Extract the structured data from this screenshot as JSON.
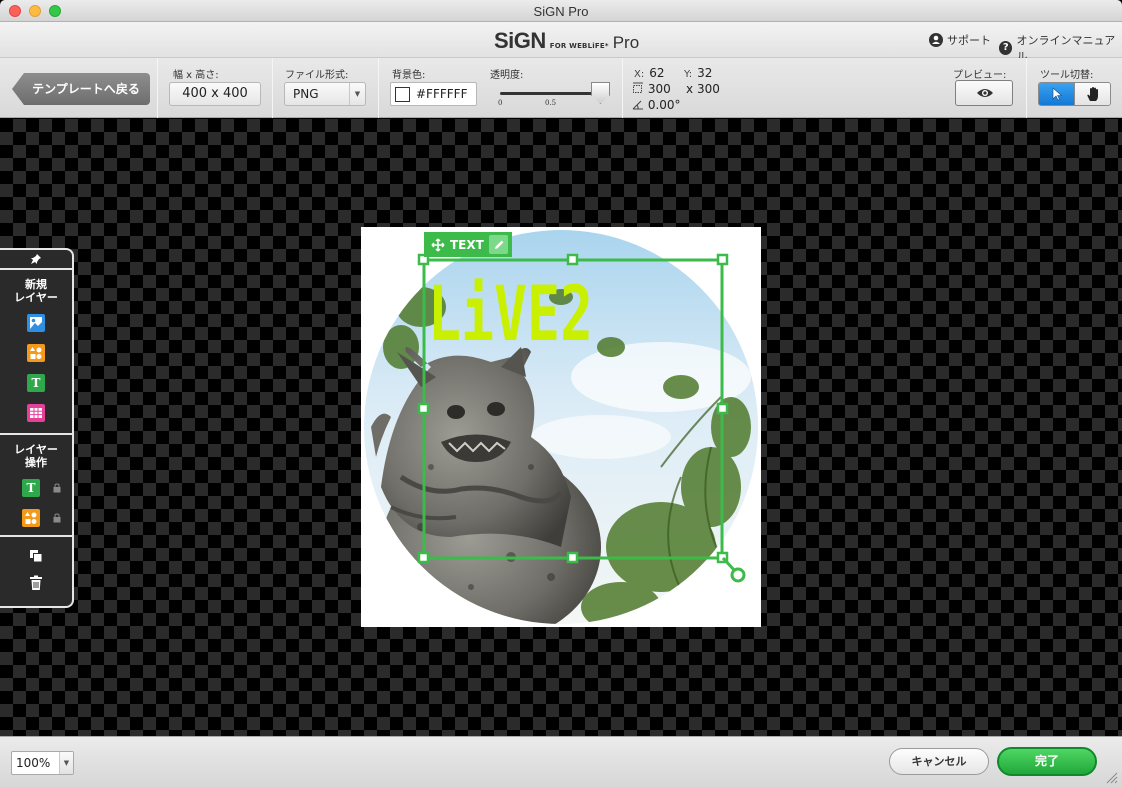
{
  "window": {
    "title": "SiGN Pro"
  },
  "header": {
    "logo_main": "SiGN",
    "logo_sub": "FOR WEBLiFE*",
    "logo_pro": "Pro",
    "support": "サポート",
    "manual": "オンラインマニュアル"
  },
  "toolbar": {
    "back": "テンプレートへ戻る",
    "size_label": "幅 x 高さ:",
    "size_value": "400 x 400",
    "format_label": "ファイル形式:",
    "format_value": "PNG",
    "bg_label": "背景色:",
    "bg_value": "#FFFFFF",
    "bg_color": "#FFFFFF",
    "opacity_label": "透明度:",
    "opacity_value": 1.0,
    "opacity_tick_0": "0",
    "opacity_tick_05": "0.5",
    "x_label": "X:",
    "x_value": "62",
    "y_label": "Y:",
    "y_value": "32",
    "w_value": "300",
    "h_prefix": "x",
    "h_value": "300",
    "angle_value": "0.00°",
    "preview_label": "プレビュー:",
    "tool_label": "ツール切替:"
  },
  "canvas": {
    "layer_tag": "TEXT",
    "text_content": "LiVE2",
    "text_color": "#c8f000",
    "selection_color": "#3dbb4a"
  },
  "side_panel": {
    "new_layer_title_1": "新規",
    "new_layer_title_2": "レイヤー",
    "ops_title_1": "レイヤー",
    "ops_title_2": "操作",
    "icons": [
      "pin-icon",
      "image-icon",
      "shape-icon",
      "text-icon",
      "table-icon",
      "text-layer-icon",
      "shape-layer-icon",
      "lock-icon",
      "duplicate-icon",
      "trash-icon"
    ]
  },
  "bottom": {
    "zoom": "100%",
    "cancel": "キャンセル",
    "done": "完了"
  }
}
